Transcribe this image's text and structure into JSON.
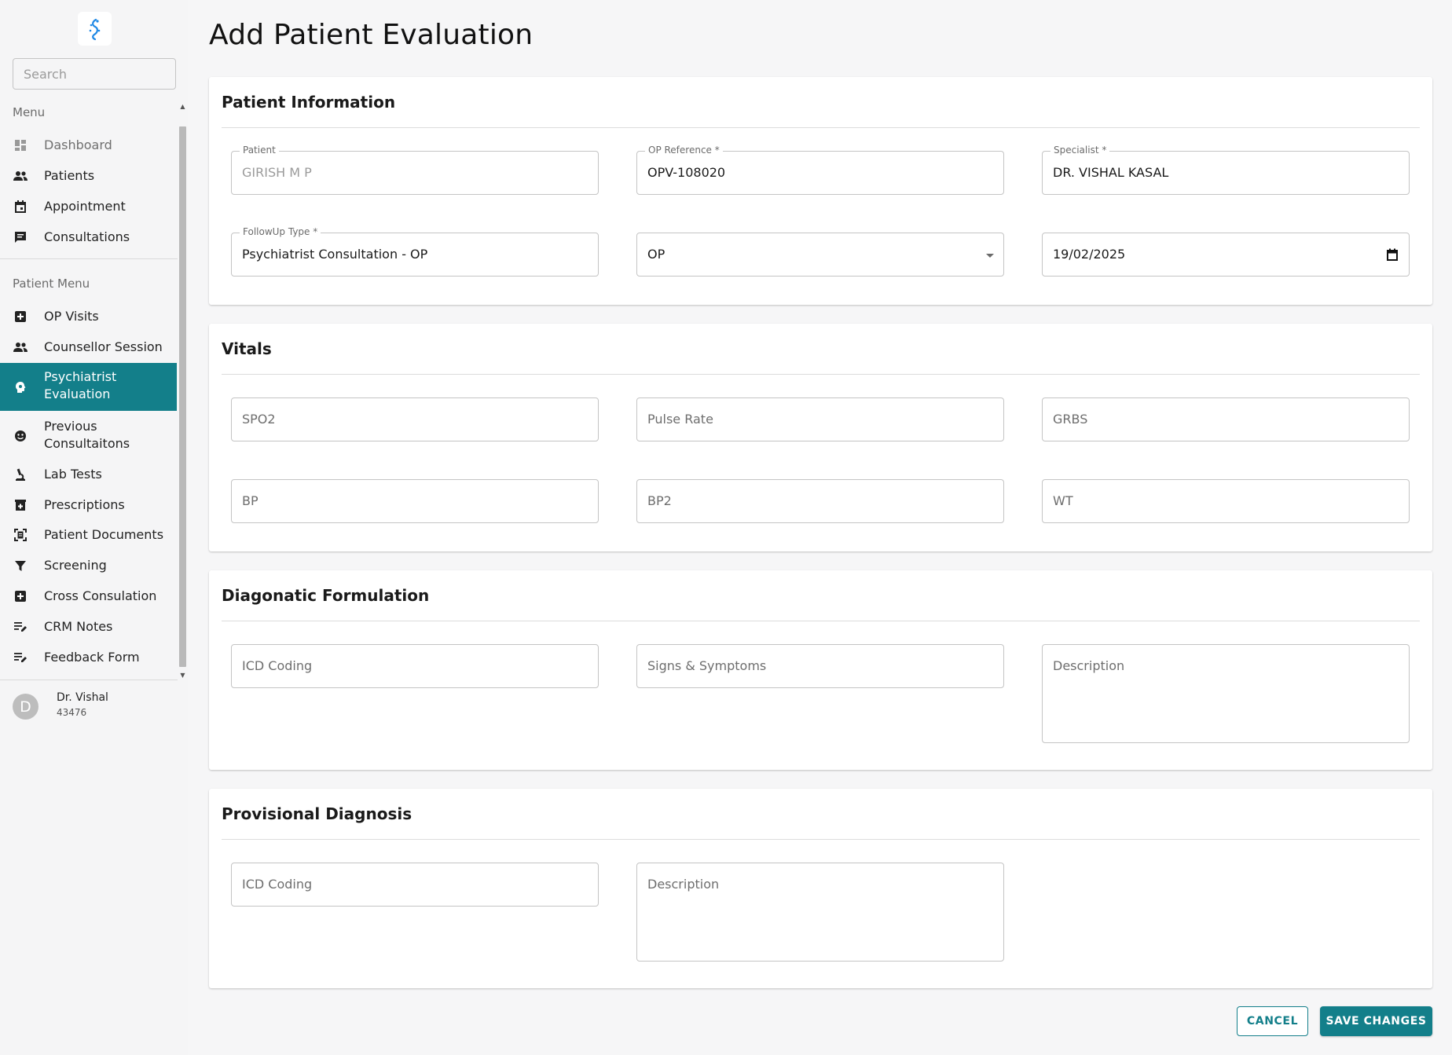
{
  "sidebar": {
    "search_placeholder": "Search",
    "menu_label": "Menu",
    "menu_items": [
      {
        "label": "Dashboard",
        "icon": "dashboard-icon"
      },
      {
        "label": "Patients",
        "icon": "people-icon"
      },
      {
        "label": "Appointment",
        "icon": "calendar-icon"
      },
      {
        "label": "Consultations",
        "icon": "chat-icon"
      }
    ],
    "patient_menu_label": "Patient Menu",
    "patient_items": [
      {
        "label": "OP Visits",
        "icon": "medical-plus-icon"
      },
      {
        "label": "Counsellor Session",
        "icon": "people-icon"
      },
      {
        "label": "Psychiatrist Evaluation",
        "icon": "psychology-icon",
        "active": true
      },
      {
        "label": "Previous Consultaitons",
        "icon": "face-icon"
      },
      {
        "label": "Lab Tests",
        "icon": "microscope-icon"
      },
      {
        "label": "Prescriptions",
        "icon": "medication-icon"
      },
      {
        "label": "Patient Documents",
        "icon": "document-scan-icon"
      },
      {
        "label": "Screening",
        "icon": "filter-icon"
      },
      {
        "label": "Cross Consulation",
        "icon": "medical-plus-icon"
      },
      {
        "label": "CRM Notes",
        "icon": "edit-note-icon"
      },
      {
        "label": "Feedback Form",
        "icon": "edit-note-icon"
      }
    ],
    "user": {
      "initial": "D",
      "name": "Dr. Vishal",
      "id": "43476"
    }
  },
  "page": {
    "title": "Add Patient Evaluation"
  },
  "patient_info": {
    "title": "Patient Information",
    "patient_label": "Patient",
    "patient_value": "GIRISH M P",
    "op_ref_label": "OP Reference *",
    "op_ref_value": "OPV-108020",
    "specialist_label": "Specialist *",
    "specialist_value": "DR. VISHAL KASAL",
    "followup_label": "FollowUp Type *",
    "followup_value": "Psychiatrist Consultation - OP",
    "visit_type_value": "OP",
    "date_value": "19/02/2025"
  },
  "vitals": {
    "title": "Vitals",
    "spo2": "SPO2",
    "pulse": "Pulse Rate",
    "grbs": "GRBS",
    "bp": "BP",
    "bp2": "BP2",
    "wt": "WT"
  },
  "diagnostic": {
    "title": "Diagonatic Formulation",
    "icd": "ICD Coding",
    "signs": "Signs & Symptoms",
    "description": "Description"
  },
  "provisional": {
    "title": "Provisional Diagnosis",
    "icd": "ICD Coding",
    "description": "Description"
  },
  "actions": {
    "cancel": "CANCEL",
    "save": "SAVE CHANGES"
  },
  "colors": {
    "accent": "#137f8a",
    "brand_logo": "#1e88e5"
  }
}
